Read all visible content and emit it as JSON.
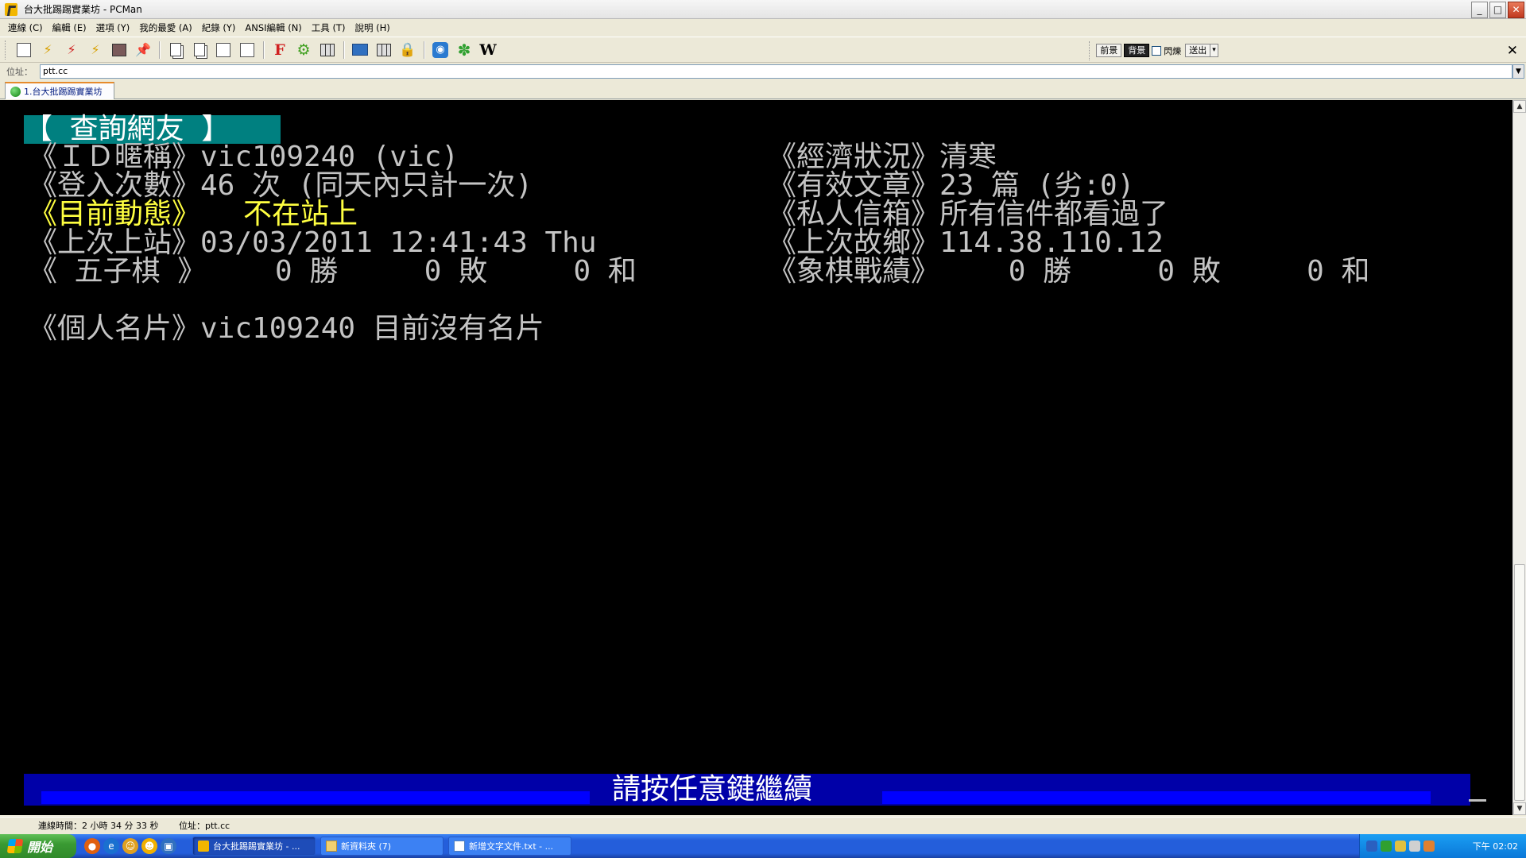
{
  "window": {
    "title": "台大批踢踢實業坊 - PCMan",
    "minimize": "_",
    "maximize": "□",
    "close": "✕"
  },
  "menu": [
    "連線 (C)",
    "編輯 (E)",
    "選項 (Y)",
    "我的最愛 (A)",
    "紀錄 (Y)",
    "ANSI編輯 (N)",
    "工具 (T)",
    "說明 (H)"
  ],
  "toolbar": {
    "right": {
      "foreground_label": "前景",
      "background_label": "背景",
      "blink_label": "閃爍",
      "send_label": "送出",
      "close_label": "✕"
    }
  },
  "address": {
    "label": "位址：",
    "value": "ptt.cc"
  },
  "tabs": [
    {
      "label": "1.台大批踢踢實業坊"
    }
  ],
  "terminal": {
    "header": "【 查詢網友 】",
    "rows": [
      {
        "left": "《ＩＤ暱稱》vic109240 (vic)",
        "right": "《經濟狀況》清寒"
      },
      {
        "left": "《登入次數》46 次 (同天內只計一次)",
        "right": "《有效文章》23 篇 (劣:0)"
      },
      {
        "left": "《目前動態》",
        "left_value": "不在站上",
        "right": "《私人信箱》所有信件都看過了"
      },
      {
        "left": "《上次上站》03/03/2011 12:41:43 Thu",
        "right": "《上次故鄉》114.38.110.12"
      },
      {
        "left": "《 五子棋 》    0 勝     0 敗     0 和",
        "right": "《象棋戰績》    0 勝     0 敗     0 和"
      }
    ],
    "card": "《個人名片》vic109240 目前沒有名片",
    "prompt": "請按任意鍵繼續"
  },
  "status": {
    "connection_time": "連線時間：2 小時 34 分 33 秒",
    "address": "位址：ptt.cc"
  },
  "taskbar": {
    "start": "開始",
    "tasks": [
      {
        "label": "台大批踢踢實業坊 - ...",
        "active": true
      },
      {
        "label": "新資料夾 (7)",
        "active": false
      },
      {
        "label": "新增文字文件.txt - ...",
        "active": false
      }
    ],
    "clock": "下午 02:02"
  },
  "colors": {
    "terminal_bg": "#000000",
    "terminal_fg": "#c4c4c4",
    "highlight": "#ffff40",
    "header_bg": "#008080",
    "prompt_bg": "#0000a8"
  }
}
